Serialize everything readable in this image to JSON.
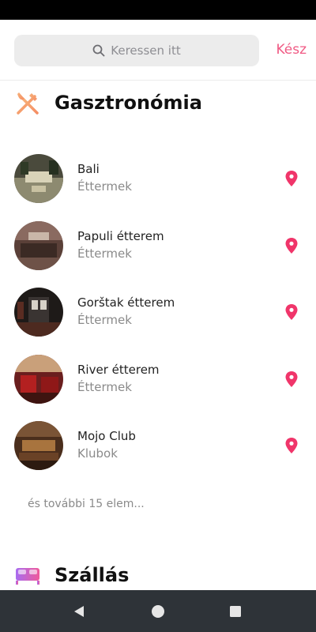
{
  "search": {
    "placeholder": "Keressen itt",
    "done_label": "Kész"
  },
  "sections": [
    {
      "title": "Gasztronómia",
      "icon": "fork-knife-icon",
      "places": [
        {
          "name": "Bali",
          "category": "Éttermek"
        },
        {
          "name": "Papuli étterem",
          "category": "Éttermek"
        },
        {
          "name": "Gorštak étterem",
          "category": "Éttermek"
        },
        {
          "name": "River étterem",
          "category": "Éttermek"
        },
        {
          "name": "Mojo Club",
          "category": "Klubok"
        }
      ],
      "more_label": "és további 15 elem..."
    },
    {
      "title": "Szállás",
      "icon": "bed-icon",
      "places": []
    }
  ],
  "colors": {
    "accent": "#f05a84",
    "pin": "#f0356a",
    "nav_bar": "#2e3338"
  }
}
